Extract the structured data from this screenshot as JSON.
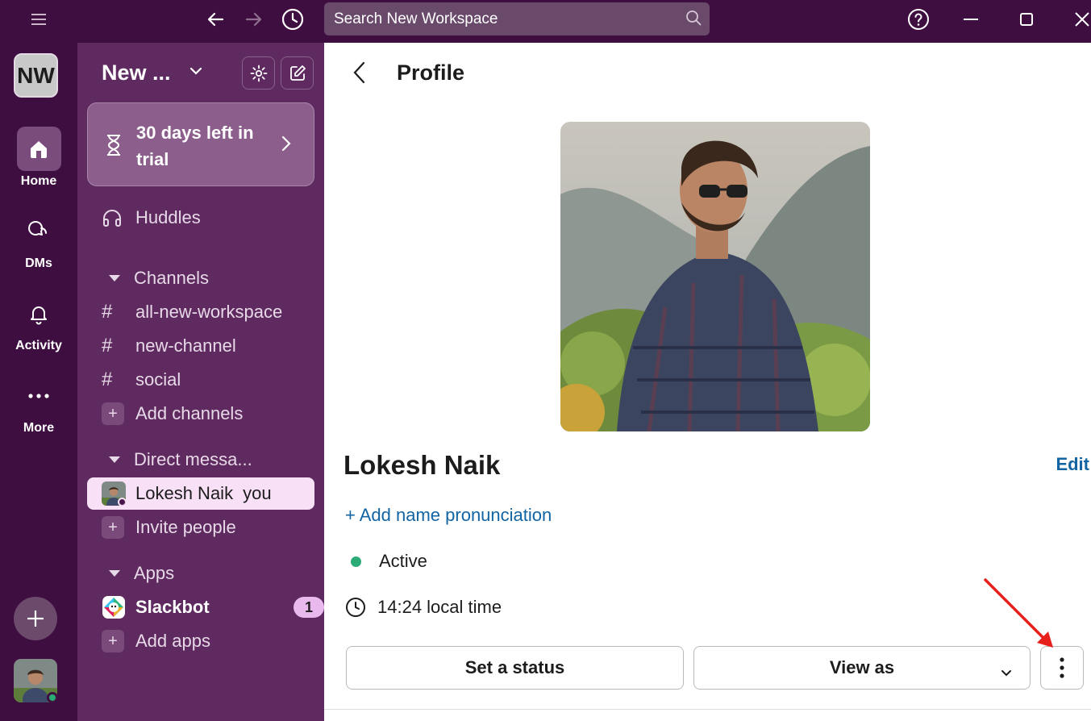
{
  "titlebar": {
    "search_placeholder": "Search New Workspace"
  },
  "rail": {
    "workspace_initials": "NW",
    "items": [
      {
        "label": "Home"
      },
      {
        "label": "DMs"
      },
      {
        "label": "Activity"
      },
      {
        "label": "More"
      }
    ]
  },
  "sidebar": {
    "workspace_name": "New ...",
    "trial_text": "30 days left in trial",
    "huddles": "Huddles",
    "channels_header": "Channels",
    "channels": [
      "all-new-workspace",
      "new-channel",
      "social"
    ],
    "add_channels": "Add channels",
    "dm_header": "Direct messa...",
    "dm_user": "Lokesh Naik",
    "dm_you": "you",
    "invite": "Invite people",
    "apps_header": "Apps",
    "slackbot": "Slackbot",
    "slackbot_badge": "1",
    "add_apps": "Add apps"
  },
  "profile": {
    "title": "Profile",
    "name": "Lokesh Naik",
    "edit": "Edit",
    "add_pronunciation": "Add name pronunciation",
    "status": "Active",
    "local_time": "14:24 local time",
    "set_status": "Set a status",
    "view_as": "View as"
  },
  "colors": {
    "rail": "#3f0e40",
    "sidebar": "#5e2a5f",
    "active_green": "#2bac76",
    "link_blue": "#1264a3",
    "annotation_arrow": "#e8201c"
  }
}
